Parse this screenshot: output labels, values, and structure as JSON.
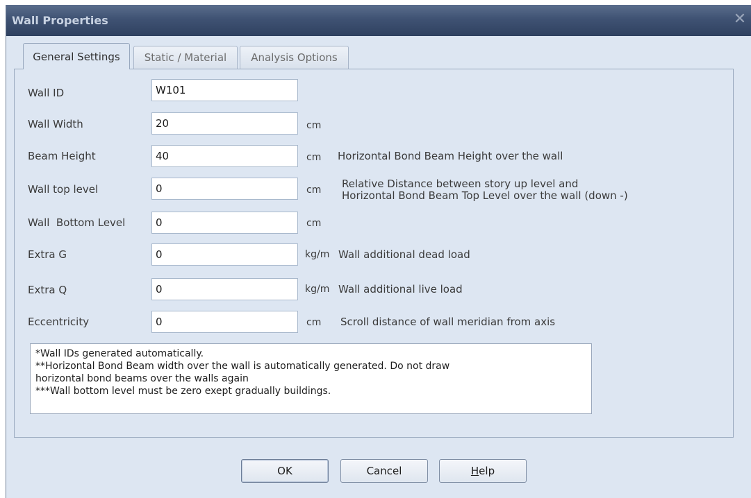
{
  "window": {
    "title": "Wall Properties",
    "close_glyph": "✕"
  },
  "tabs": [
    {
      "label": "General Settings",
      "active": true
    },
    {
      "label": "Static / Material",
      "active": false
    },
    {
      "label": "Analysis Options",
      "active": false
    }
  ],
  "fields": {
    "wall_id": {
      "label": "Wall ID",
      "value": "W101"
    },
    "wall_width": {
      "label": "Wall Width",
      "value": "20",
      "unit": "cm"
    },
    "beam_height": {
      "label": "Beam Height",
      "value": "40",
      "unit": "cm",
      "description": "Horizontal Bond Beam Height over the wall"
    },
    "wall_top_level": {
      "label": "Wall top level",
      "value": "0",
      "unit": "cm",
      "description_line1": "Relative Distance between story up level and",
      "description_line2": "Horizontal Bond Beam Top Level over the wall (down -)"
    },
    "wall_bottom_level": {
      "label": "Wall  Bottom Level",
      "value": "0",
      "unit": "cm"
    },
    "extra_g": {
      "label": "Extra G",
      "value": "0",
      "unit": "kg/m",
      "description": "Wall additional dead load"
    },
    "extra_q": {
      "label": "Extra Q",
      "value": "0",
      "unit": "kg/m",
      "description": "Wall additional live load"
    },
    "eccentricity": {
      "label": "Eccentricity",
      "value": "0",
      "unit": "cm",
      "description": "Scroll distance of wall meridian from axis"
    }
  },
  "notes": [
    "*Wall IDs generated automatically.",
    "**Horizontal Bond Beam width over the wall is automatically generated. Do not draw",
    "horizontal bond beams over the walls again",
    "***Wall bottom level must be zero exept gradually buildings."
  ],
  "buttons": {
    "ok": "OK",
    "cancel": "Cancel",
    "help_underlined": "H",
    "help_rest": "elp"
  },
  "colors": {
    "titlebar": "#3f5273",
    "dialog_bg": "#dde6f2",
    "input_bg": "#ffffff"
  }
}
